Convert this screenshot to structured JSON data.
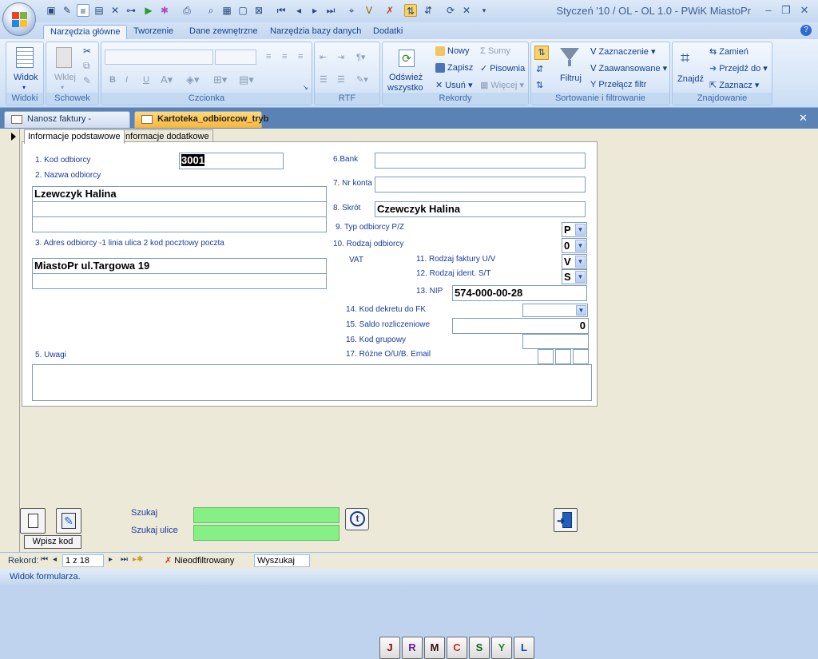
{
  "window": {
    "title": "Styczeń '10 / OL - OL 1.0 - PWiK MiastoPr"
  },
  "ribbon_tabs": [
    "Narzędzia główne",
    "Tworzenie",
    "Dane zewnętrzne",
    "Narzędzia bazy danych",
    "Dodatki"
  ],
  "groups": {
    "widoki": {
      "label": "Widoki",
      "widok": "Widok"
    },
    "schowek": {
      "label": "Schowek",
      "wklej": "Wklej"
    },
    "czcionka": {
      "label": "Czcionka"
    },
    "rtf": {
      "label": "RTF"
    },
    "rekordy": {
      "label": "Rekordy",
      "odswiez1": "Odśwież",
      "odswiez2": "wszystko",
      "nowy": "Nowy",
      "zapisz": "Zapisz",
      "usun": "Usuń",
      "sumy": "Sumy",
      "pisownia": "Pisownia",
      "wiecej": "Więcej"
    },
    "sortowanie": {
      "label": "Sortowanie i filtrowanie",
      "filtruj": "Filtruj",
      "zaznaczenie": "Zaznaczenie",
      "zaawansowane": "Zaawansowane",
      "przelacz": "Przełącz filtr"
    },
    "znajdowanie": {
      "label": "Znajdowanie",
      "znajdz": "Znajdź",
      "zamien": "Zamień",
      "przejdz": "Przejdź do",
      "zaznacz": "Zaznacz"
    }
  },
  "doc_tabs": [
    "Nanosz faktury - dowolne",
    "Kartoteka_odbiorcow_tryb"
  ],
  "form_tabs": [
    "Informacje podstawowe",
    "Informacje dodatkowe"
  ],
  "fields": {
    "kod_label": "1. Kod   odbiorcy",
    "kod_value": "3001",
    "nazwa_label": "2. Nazwa odbiorcy",
    "nazwa_value": "Lzewczyk Halina",
    "adres_label": "3. Adres odbiorcy -1 linia ulica 2 kod pocztowy poczta",
    "adres_value": "MiastoPr ul.Targowa 19",
    "uwagi_label": "5. Uwagi",
    "bank_label": "6.Bank",
    "konto_label": "7. Nr konta",
    "skrot_label": "8. Skrót",
    "skrot_value": "Czewczyk Halina",
    "typ_label": "9. Typ odbiorcy P/Z",
    "typ_value": "P",
    "rodzaj_label": "10. Rodzaj odbiorcy",
    "rodzaj_value": "0",
    "vat_label": "VAT",
    "faktura_label": "11. Rodzaj faktury U/V",
    "faktura_value": "V",
    "ident_label": "12. Rodzaj ident. S/T",
    "ident_value": "S",
    "nip_label": "13. NIP",
    "nip_value": "574-000-00-28",
    "dekret_label": "14. Kod dekretu do FK",
    "saldo_label": "15. Saldo rozliczeniowe",
    "saldo_value": "0",
    "grupowy_label": "16. Kod grupowy",
    "rozne_label": "17. Różne O/U/B. Email"
  },
  "bottom": {
    "wpisz_kod": "Wpisz kod",
    "szukaj_label": "Szukaj",
    "szukaj_ulice_label": "Szukaj ulice",
    "letters": [
      "J",
      "R",
      "M",
      "C",
      "S",
      "Y",
      "L"
    ],
    "letter_colors": [
      "#8b0000",
      "#6a1b9a",
      "#3b0a0a",
      "#c62828",
      "#1b5e20",
      "#2e7d32",
      "#0d47a1"
    ]
  },
  "navbar": {
    "rekord_label": "Rekord:",
    "position": "1 z 18",
    "filter": "Nieodfiltrowany",
    "search": "Wyszukaj"
  },
  "status": {
    "text": "Widok formularza."
  }
}
